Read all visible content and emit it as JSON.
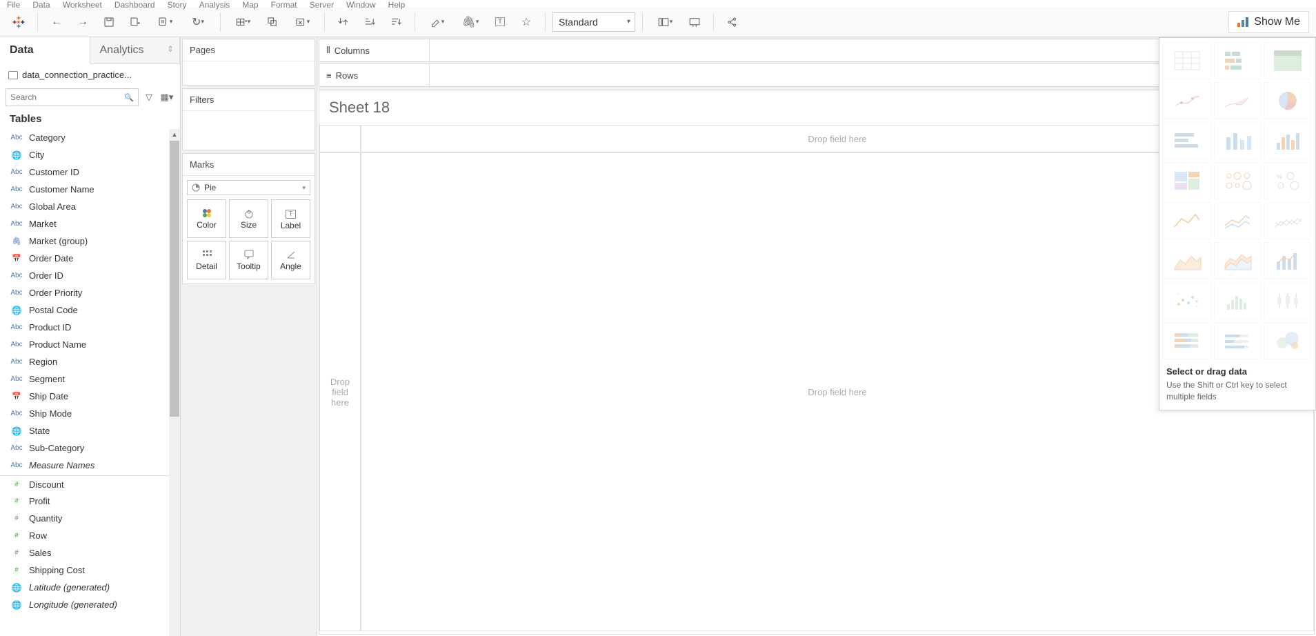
{
  "menu": {
    "items": [
      "File",
      "Data",
      "Worksheet",
      "Dashboard",
      "Story",
      "Analysis",
      "Map",
      "Format",
      "Server",
      "Window",
      "Help"
    ]
  },
  "toolbar": {
    "fit": "Standard",
    "showme": "Show Me"
  },
  "sidebar": {
    "tabs": {
      "data": "Data",
      "analytics": "Analytics"
    },
    "datasource": "data_connection_practice...",
    "search_placeholder": "Search",
    "tables_header": "Tables",
    "fields": [
      {
        "type": "abc",
        "name": "Category"
      },
      {
        "type": "globe",
        "name": "City"
      },
      {
        "type": "abc",
        "name": "Customer ID"
      },
      {
        "type": "abc",
        "name": "Customer Name"
      },
      {
        "type": "abc",
        "name": "Global Area"
      },
      {
        "type": "abc",
        "name": "Market"
      },
      {
        "type": "clip",
        "name": "Market (group)"
      },
      {
        "type": "cal",
        "name": "Order Date"
      },
      {
        "type": "abc",
        "name": "Order ID"
      },
      {
        "type": "abc",
        "name": "Order Priority"
      },
      {
        "type": "globe",
        "name": "Postal Code"
      },
      {
        "type": "abc",
        "name": "Product ID"
      },
      {
        "type": "abc",
        "name": "Product Name"
      },
      {
        "type": "abc",
        "name": "Region"
      },
      {
        "type": "abc",
        "name": "Segment"
      },
      {
        "type": "cal",
        "name": "Ship Date"
      },
      {
        "type": "abc",
        "name": "Ship Mode"
      },
      {
        "type": "globe",
        "name": "State"
      },
      {
        "type": "abc",
        "name": "Sub-Category"
      },
      {
        "type": "abc",
        "name": "Measure Names",
        "italic": true,
        "sep": false
      },
      {
        "type": "num",
        "name": "Discount",
        "sep": true
      },
      {
        "type": "num",
        "name": "Profit"
      },
      {
        "type": "num",
        "name": "Quantity"
      },
      {
        "type": "num",
        "name": "Row"
      },
      {
        "type": "num",
        "name": "Sales"
      },
      {
        "type": "num",
        "name": "Shipping Cost"
      },
      {
        "type": "globe",
        "name": "Latitude (generated)",
        "italic": true
      },
      {
        "type": "globe",
        "name": "Longitude (generated)",
        "italic": true,
        "cut": true
      }
    ]
  },
  "shelves": {
    "pages": "Pages",
    "filters": "Filters",
    "marks": "Marks",
    "mark_type": "Pie",
    "cards": [
      "Color",
      "Size",
      "Label",
      "Detail",
      "Tooltip",
      "Angle"
    ],
    "columns": "Columns",
    "rows": "Rows"
  },
  "sheet": {
    "title": "Sheet 18",
    "drop": "Drop field here",
    "drop_multi": "Drop\nfield\nhere"
  },
  "showme_panel": {
    "header": "Select or drag data",
    "sub": "Use the Shift or Ctrl key to select multiple fields"
  }
}
